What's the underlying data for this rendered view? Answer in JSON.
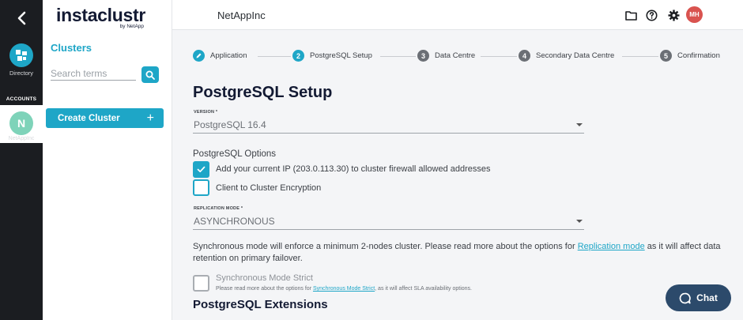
{
  "rail": {
    "directory_label": "Directory",
    "accounts_label": "ACCOUNTS",
    "account_initial": "N",
    "account_name": "NetAppInc"
  },
  "sidebar": {
    "logo": "instaclustr",
    "logo_sub": "by NetApp",
    "title": "Clusters",
    "search_placeholder": "Search terms",
    "create_label": "Create Cluster",
    "create_plus": "+"
  },
  "header": {
    "org_name": "NetAppInc",
    "user_initials": "MH",
    "icons": [
      "folder-icon",
      "help-icon",
      "gear-icon"
    ]
  },
  "stepper": {
    "steps": [
      {
        "num": "",
        "label": "Application",
        "state": "done"
      },
      {
        "num": "2",
        "label": "PostgreSQL Setup",
        "state": "active"
      },
      {
        "num": "3",
        "label": "Data Centre",
        "state": "inactive"
      },
      {
        "num": "4",
        "label": "Secondary Data Centre",
        "state": "inactive"
      },
      {
        "num": "5",
        "label": "Confirmation",
        "state": "inactive"
      }
    ]
  },
  "form": {
    "title": "PostgreSQL Setup",
    "version_label": "VERSION *",
    "version_value": "PostgreSQL 16.4",
    "options_title": "PostgreSQL Options",
    "opt_firewall": "Add your current IP (203.0.113.30) to cluster firewall allowed addresses",
    "opt_encryption": "Client to Cluster Encryption",
    "replication_label": "REPLICATION MODE *",
    "replication_value": "ASYNCHRONOUS",
    "sync_desc_pre": "Synchronous mode will enforce a minimum 2-nodes cluster. Please read more about the options for ",
    "sync_desc_link": "Replication mode",
    "sync_desc_post": " as it will affect data retention on primary failover.",
    "strict_label": "Synchronous Mode Strict",
    "strict_desc_pre": "Please read more about the options for ",
    "strict_desc_link": "Synchronous Mode Strict",
    "strict_desc_post": ", as it will affect SLA availability options.",
    "extensions_title": "PostgreSQL Extensions"
  },
  "chat": {
    "label": "Chat"
  },
  "colors": {
    "accent": "#1ea6c7",
    "rail": "#1b1d21",
    "chat": "#2c4a6b",
    "avatar": "#d9534f",
    "account": "#7ed3b9"
  }
}
